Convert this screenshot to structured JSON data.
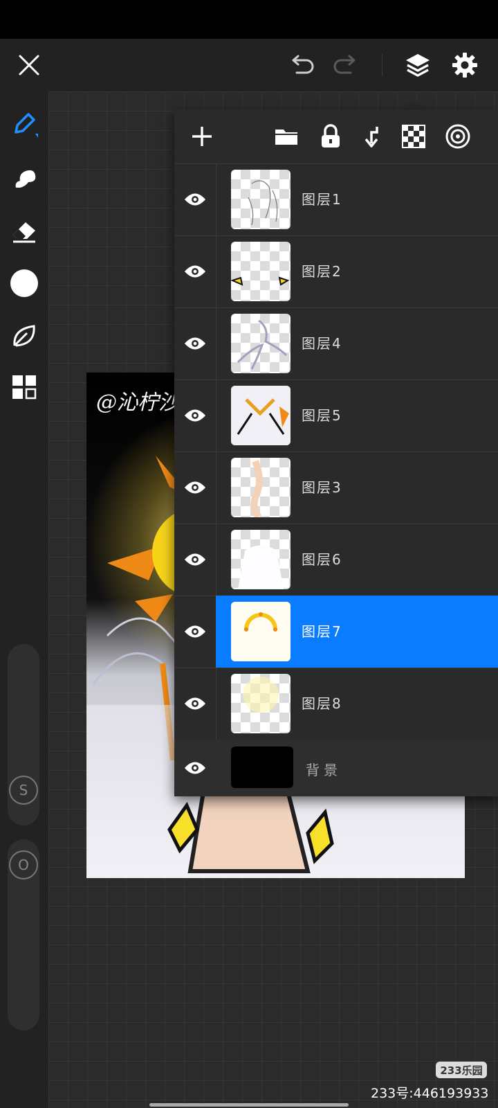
{
  "toolbar": {
    "close_icon": "close-icon",
    "undo_icon": "undo-icon",
    "redo_icon": "redo-icon",
    "layers_icon": "layers-icon",
    "settings_icon": "gear-icon"
  },
  "sidebar": {
    "tools": [
      "brush-icon",
      "smudge-icon",
      "eraser-icon",
      "color-swatch",
      "leaf-icon",
      "grid-icon"
    ],
    "color": "#ffffff",
    "size_knob": "S",
    "opacity_knob": "O"
  },
  "artwork": {
    "signature": "@沁柠沙"
  },
  "layers_panel": {
    "actions": [
      "add-layer-icon",
      "folder-icon",
      "lock-icon",
      "merge-down-icon",
      "transparency-icon",
      "target-icon"
    ],
    "layers": [
      {
        "name": "图层1",
        "visible": true,
        "selected": false
      },
      {
        "name": "图层2",
        "visible": true,
        "selected": false
      },
      {
        "name": "图层4",
        "visible": true,
        "selected": false
      },
      {
        "name": "图层5",
        "visible": true,
        "selected": false
      },
      {
        "name": "图层3",
        "visible": true,
        "selected": false
      },
      {
        "name": "图层6",
        "visible": true,
        "selected": false
      },
      {
        "name": "图层7",
        "visible": true,
        "selected": true
      },
      {
        "name": "图层8",
        "visible": true,
        "selected": false
      },
      {
        "name": "背景",
        "visible": true,
        "selected": false
      }
    ]
  },
  "watermark": {
    "badge": "233乐园",
    "id_text": "233号:446193933"
  },
  "colors": {
    "accent": "#0a7cff",
    "panel": "#2a2a2a",
    "toolbar": "#222222"
  }
}
